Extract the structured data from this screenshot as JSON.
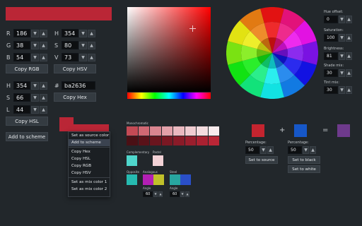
{
  "current_color": "#ba2636",
  "rgb": {
    "r_label": "R",
    "r": "186",
    "g_label": "G",
    "g": "38",
    "b_label": "B",
    "b": "54",
    "copy_label": "Copy RGB"
  },
  "hsv": {
    "h_label": "H",
    "h": "354",
    "s_label": "S",
    "s": "80",
    "v_label": "V",
    "v": "73",
    "copy_label": "Copy HSV"
  },
  "hsl": {
    "h_label": "H",
    "h": "354",
    "s_label": "S",
    "s": "66",
    "l_label": "L",
    "l": "44",
    "copy_label": "Copy HSL"
  },
  "hex": {
    "label": "#",
    "value": "ba2636",
    "copy_label": "Copy Hex"
  },
  "add_to_scheme_label": "Add to scheme",
  "context_menu": {
    "items": [
      "Set as source color",
      "Add to scheme",
      "Copy Hex",
      "Copy HSL",
      "Copy RGB",
      "Copy HSV",
      "Set as mix color 1",
      "Set as mix color 2"
    ]
  },
  "scheme": {
    "title": "Monochromatic",
    "complementary_label": "Complementary",
    "pastel_label": "Pastel",
    "opposite_label": "Opposite",
    "analogous_label": "Analogous",
    "steel_label": "Steel",
    "angle1_label": "Angle",
    "angle1_value": "60",
    "angle2_label": "Angle",
    "angle2_value": "60",
    "mono_row1": [
      "#c44a55",
      "#d06873",
      "#da8590",
      "#e3a1aa",
      "#eab9c0",
      "#f0ccd1",
      "#f4dcdf",
      "#f8ebed"
    ],
    "mono_row2": [
      "#4a1015",
      "#5a1219",
      "#6a151e",
      "#7a1823",
      "#8a1b28",
      "#9a1e2d",
      "#aa2131",
      "#ba2636"
    ],
    "complementary_color": "#4fd6cc",
    "pastel_color": "#f2d2d6",
    "opposite_color": "#26bab0",
    "analogous_colors": [
      "#b31fb3",
      "#c0c02a"
    ],
    "steel_colors": [
      "#28a6a0",
      "#2a4fc8"
    ]
  },
  "wheel_panel": {
    "hue_offset_label": "Hue offset:",
    "hue_offset": "0",
    "saturation_label": "Saturation:",
    "saturation": "100",
    "brightness_label": "Brightness:",
    "brightness": "81",
    "shade_mix_label": "Shade mix:",
    "shade_mix": "30",
    "tint_mix_label": "Tint mix:",
    "tint_mix": "30"
  },
  "mixer": {
    "color1": "#c4242f",
    "color2": "#1657c8",
    "result": "#6e3a8c",
    "plus": "+",
    "equals": "=",
    "pct1_label": "Percentage:",
    "pct1": "50",
    "pct2_label": "Percentage:",
    "pct2": "50",
    "set_to_source_label": "Set to source",
    "set_to_black_label": "Set to black",
    "set_to_white_label": "Set to white"
  }
}
